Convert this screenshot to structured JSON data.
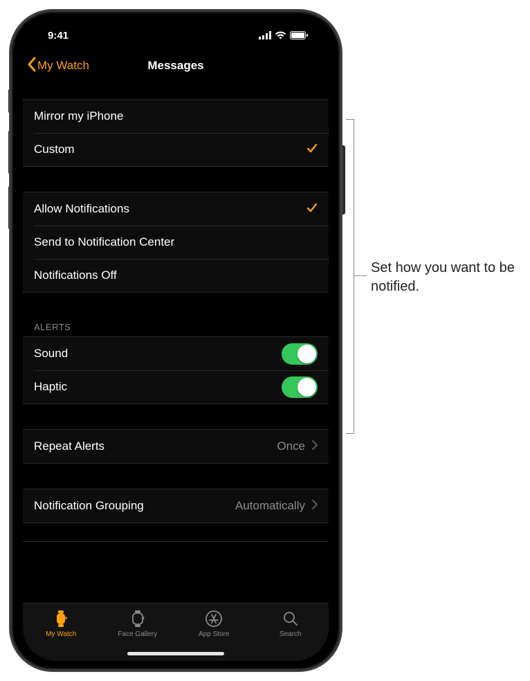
{
  "status": {
    "time": "9:41"
  },
  "nav": {
    "back": "My Watch",
    "title": "Messages"
  },
  "section_mode": {
    "mirror": "Mirror my iPhone",
    "custom": "Custom"
  },
  "section_notif": {
    "allow": "Allow Notifications",
    "send_center": "Send to Notification Center",
    "off": "Notifications Off"
  },
  "section_alerts": {
    "header": "ALERTS",
    "sound": "Sound",
    "haptic": "Haptic"
  },
  "section_repeat": {
    "label": "Repeat Alerts",
    "value": "Once"
  },
  "section_grouping": {
    "label": "Notification Grouping",
    "value": "Automatically"
  },
  "tabs": {
    "mywatch": "My Watch",
    "gallery": "Face Gallery",
    "appstore": "App Store",
    "search": "Search"
  },
  "callout": "Set how you want to be notified."
}
